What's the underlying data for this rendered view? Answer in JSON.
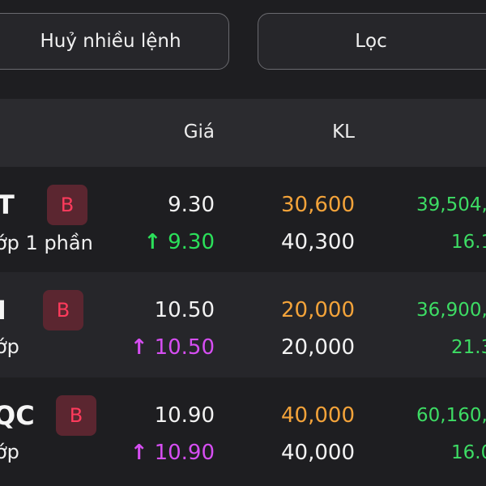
{
  "toolbar": {
    "cancel_multiple_label": "Huỷ nhiều lệnh",
    "filter_label": "Lọc"
  },
  "table": {
    "columns": {
      "price": "Giá",
      "volume": "KL"
    },
    "rows": [
      {
        "symbol": "T",
        "side": "B",
        "status": "ớp 1 phần",
        "order_price": "9.30",
        "matched_price": "9.30",
        "order_volume": "30,600",
        "matched_volume": "40,300",
        "value": "39,504,",
        "sub_value": "16.1"
      },
      {
        "symbol": "I",
        "side": "B",
        "status": "ớp",
        "order_price": "10.50",
        "matched_price": "10.50",
        "order_volume": "20,000",
        "matched_volume": "20,000",
        "value": "36,900,",
        "sub_value": "21.3"
      },
      {
        "symbol": "QC",
        "side": "B",
        "status": "ớp",
        "order_price": "10.90",
        "matched_price": "10.90",
        "order_volume": "40,000",
        "matched_volume": "40,000",
        "value": "60,160,",
        "sub_value": "16.0"
      }
    ]
  },
  "icons": {
    "up": "↑"
  },
  "colors": {
    "background": "#1e1e21",
    "header_background": "#2b2b2f",
    "buy_badge_text": "#ff3b5c",
    "buy_badge_background": "#5b2630",
    "volume_orange": "#f3a33a",
    "value_green": "#3ddc64",
    "arrow_green": "#2be05a",
    "arrow_purple": "#d64ef2"
  }
}
